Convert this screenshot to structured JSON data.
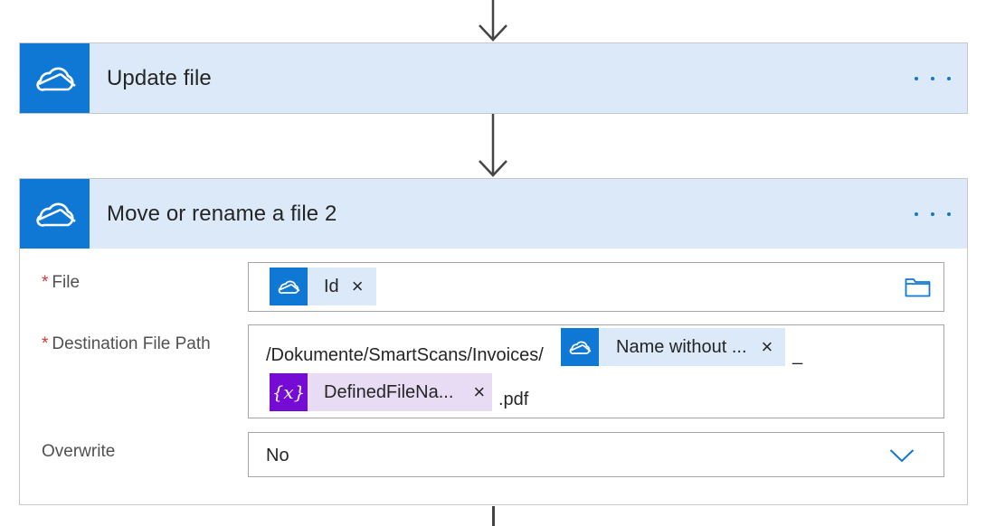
{
  "colors": {
    "accent": "#0f78d4",
    "header_bg": "#dbe9f8",
    "variable_token": "#770bd6",
    "required_star": "#d13438"
  },
  "update_file_card": {
    "title": "Update file",
    "icon": "onedrive-cloud-icon",
    "more_label": "more-options"
  },
  "move_card": {
    "title": "Move or rename a file 2",
    "icon": "onedrive-cloud-icon",
    "fields": {
      "file": {
        "required_mark": "*",
        "label": "File",
        "token": {
          "icon": "onedrive-cloud-icon",
          "label": "Id",
          "close": "×"
        },
        "picker_icon": "folder-icon"
      },
      "destination": {
        "required_mark": "*",
        "label": "Destination File Path",
        "prefix_text": "/Dokumente/SmartScans/Invoices/",
        "token1": {
          "icon": "onedrive-cloud-icon",
          "label": "Name without ...",
          "close": "×"
        },
        "separator_text": "_",
        "token2": {
          "icon": "variable-icon",
          "glyph": "{x}",
          "label": "DefinedFileNa...",
          "close": "×"
        },
        "suffix_text": ".pdf"
      },
      "overwrite": {
        "label": "Overwrite",
        "value": "No",
        "dropdown_icon": "chevron-down-icon"
      }
    }
  }
}
